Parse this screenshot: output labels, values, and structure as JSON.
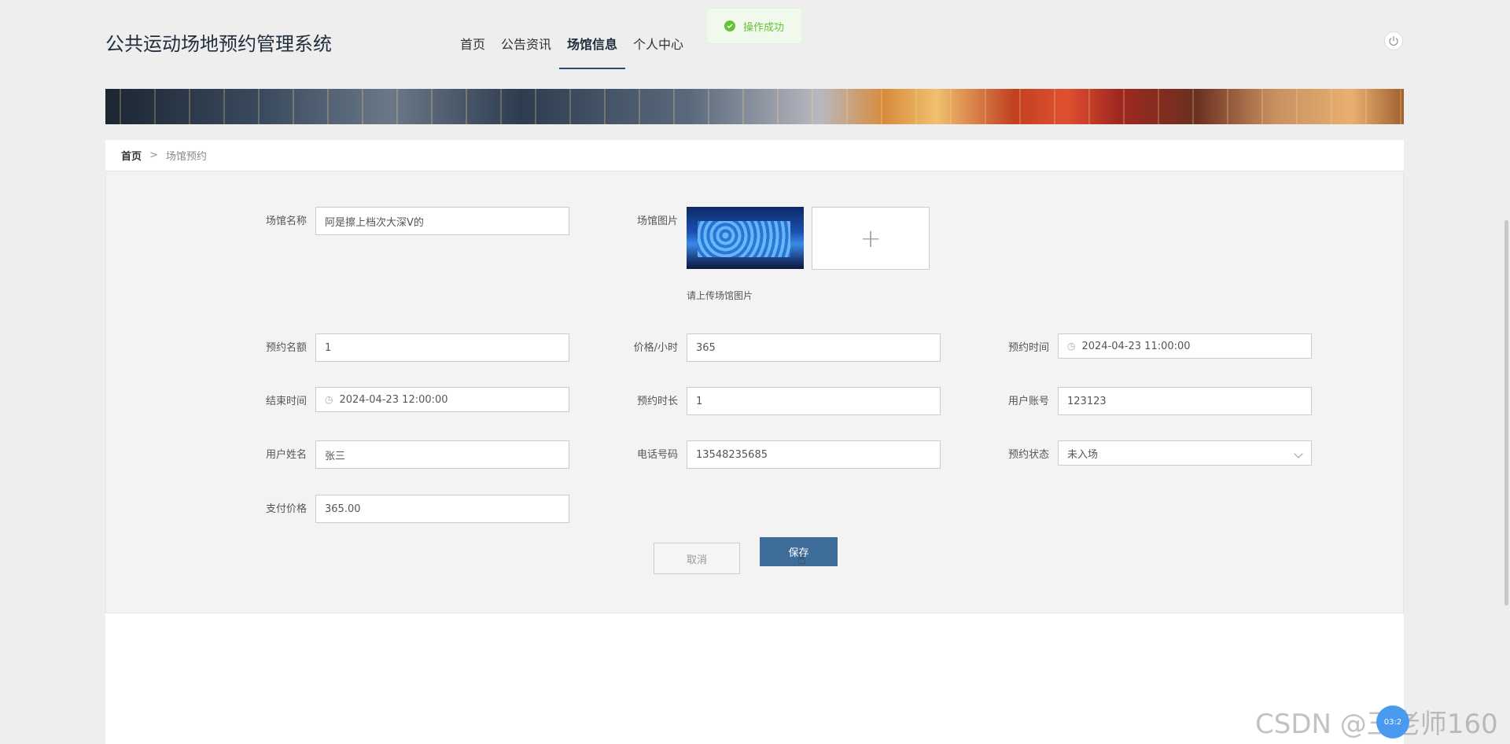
{
  "app": {
    "title": "公共运动场地预约管理系统"
  },
  "nav": {
    "items": [
      {
        "label": "首页"
      },
      {
        "label": "公告资讯"
      },
      {
        "label": "场馆信息"
      },
      {
        "label": "个人中心"
      }
    ],
    "active_index": 2
  },
  "toast": {
    "text": "操作成功",
    "type": "success"
  },
  "breadcrumb": {
    "home": "首页",
    "separator": ">",
    "current": "场馆预约"
  },
  "form": {
    "venue_name": {
      "label": "场馆名称",
      "value": "阿是擦上档次大深V的"
    },
    "venue_image": {
      "label": "场馆图片",
      "hint": "请上传场馆图片",
      "add_icon": "+"
    },
    "quota": {
      "label": "预约名额",
      "value": "1"
    },
    "price_per_hour": {
      "label": "价格/小时",
      "value": "365"
    },
    "booking_time": {
      "label": "预约时间",
      "value": "2024-04-23 11:00:00"
    },
    "end_time": {
      "label": "结束时间",
      "value": "2024-04-23 12:00:00"
    },
    "duration": {
      "label": "预约时长",
      "value": "1"
    },
    "user_account": {
      "label": "用户账号",
      "value": "123123"
    },
    "user_name": {
      "label": "用户姓名",
      "value": "张三"
    },
    "phone": {
      "label": "电话号码",
      "value": "13548235685"
    },
    "status": {
      "label": "预约状态",
      "value": "未入场"
    },
    "pay_price": {
      "label": "支付价格",
      "value": "365.00"
    }
  },
  "buttons": {
    "cancel": "取消",
    "save": "保存"
  },
  "watermark": "CSDN @王老师160",
  "badge": "03:2",
  "colors": {
    "primary": "#3f6d9a",
    "toast_green": "#67c23a"
  },
  "icons": {
    "power": "power-icon",
    "clock": "clock-icon",
    "check": "check-icon",
    "plus": "plus-icon"
  }
}
